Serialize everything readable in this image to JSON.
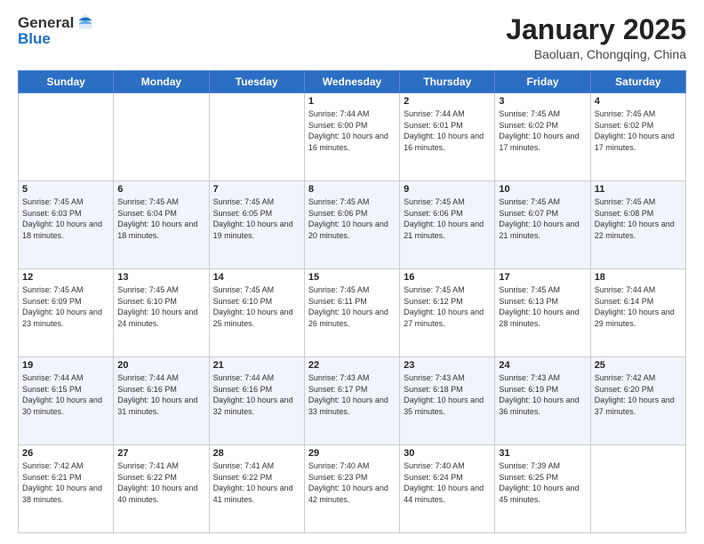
{
  "header": {
    "logo_line1": "General",
    "logo_line2": "Blue",
    "month_title": "January 2025",
    "location": "Baoluan, Chongqing, China"
  },
  "days_of_week": [
    "Sunday",
    "Monday",
    "Tuesday",
    "Wednesday",
    "Thursday",
    "Friday",
    "Saturday"
  ],
  "weeks": [
    [
      {
        "num": "",
        "info": ""
      },
      {
        "num": "",
        "info": ""
      },
      {
        "num": "",
        "info": ""
      },
      {
        "num": "1",
        "info": "Sunrise: 7:44 AM\nSunset: 6:00 PM\nDaylight: 10 hours and 16 minutes."
      },
      {
        "num": "2",
        "info": "Sunrise: 7:44 AM\nSunset: 6:01 PM\nDaylight: 10 hours and 16 minutes."
      },
      {
        "num": "3",
        "info": "Sunrise: 7:45 AM\nSunset: 6:02 PM\nDaylight: 10 hours and 17 minutes."
      },
      {
        "num": "4",
        "info": "Sunrise: 7:45 AM\nSunset: 6:02 PM\nDaylight: 10 hours and 17 minutes."
      }
    ],
    [
      {
        "num": "5",
        "info": "Sunrise: 7:45 AM\nSunset: 6:03 PM\nDaylight: 10 hours and 18 minutes."
      },
      {
        "num": "6",
        "info": "Sunrise: 7:45 AM\nSunset: 6:04 PM\nDaylight: 10 hours and 18 minutes."
      },
      {
        "num": "7",
        "info": "Sunrise: 7:45 AM\nSunset: 6:05 PM\nDaylight: 10 hours and 19 minutes."
      },
      {
        "num": "8",
        "info": "Sunrise: 7:45 AM\nSunset: 6:06 PM\nDaylight: 10 hours and 20 minutes."
      },
      {
        "num": "9",
        "info": "Sunrise: 7:45 AM\nSunset: 6:06 PM\nDaylight: 10 hours and 21 minutes."
      },
      {
        "num": "10",
        "info": "Sunrise: 7:45 AM\nSunset: 6:07 PM\nDaylight: 10 hours and 21 minutes."
      },
      {
        "num": "11",
        "info": "Sunrise: 7:45 AM\nSunset: 6:08 PM\nDaylight: 10 hours and 22 minutes."
      }
    ],
    [
      {
        "num": "12",
        "info": "Sunrise: 7:45 AM\nSunset: 6:09 PM\nDaylight: 10 hours and 23 minutes."
      },
      {
        "num": "13",
        "info": "Sunrise: 7:45 AM\nSunset: 6:10 PM\nDaylight: 10 hours and 24 minutes."
      },
      {
        "num": "14",
        "info": "Sunrise: 7:45 AM\nSunset: 6:10 PM\nDaylight: 10 hours and 25 minutes."
      },
      {
        "num": "15",
        "info": "Sunrise: 7:45 AM\nSunset: 6:11 PM\nDaylight: 10 hours and 26 minutes."
      },
      {
        "num": "16",
        "info": "Sunrise: 7:45 AM\nSunset: 6:12 PM\nDaylight: 10 hours and 27 minutes."
      },
      {
        "num": "17",
        "info": "Sunrise: 7:45 AM\nSunset: 6:13 PM\nDaylight: 10 hours and 28 minutes."
      },
      {
        "num": "18",
        "info": "Sunrise: 7:44 AM\nSunset: 6:14 PM\nDaylight: 10 hours and 29 minutes."
      }
    ],
    [
      {
        "num": "19",
        "info": "Sunrise: 7:44 AM\nSunset: 6:15 PM\nDaylight: 10 hours and 30 minutes."
      },
      {
        "num": "20",
        "info": "Sunrise: 7:44 AM\nSunset: 6:16 PM\nDaylight: 10 hours and 31 minutes."
      },
      {
        "num": "21",
        "info": "Sunrise: 7:44 AM\nSunset: 6:16 PM\nDaylight: 10 hours and 32 minutes."
      },
      {
        "num": "22",
        "info": "Sunrise: 7:43 AM\nSunset: 6:17 PM\nDaylight: 10 hours and 33 minutes."
      },
      {
        "num": "23",
        "info": "Sunrise: 7:43 AM\nSunset: 6:18 PM\nDaylight: 10 hours and 35 minutes."
      },
      {
        "num": "24",
        "info": "Sunrise: 7:43 AM\nSunset: 6:19 PM\nDaylight: 10 hours and 36 minutes."
      },
      {
        "num": "25",
        "info": "Sunrise: 7:42 AM\nSunset: 6:20 PM\nDaylight: 10 hours and 37 minutes."
      }
    ],
    [
      {
        "num": "26",
        "info": "Sunrise: 7:42 AM\nSunset: 6:21 PM\nDaylight: 10 hours and 38 minutes."
      },
      {
        "num": "27",
        "info": "Sunrise: 7:41 AM\nSunset: 6:22 PM\nDaylight: 10 hours and 40 minutes."
      },
      {
        "num": "28",
        "info": "Sunrise: 7:41 AM\nSunset: 6:22 PM\nDaylight: 10 hours and 41 minutes."
      },
      {
        "num": "29",
        "info": "Sunrise: 7:40 AM\nSunset: 6:23 PM\nDaylight: 10 hours and 42 minutes."
      },
      {
        "num": "30",
        "info": "Sunrise: 7:40 AM\nSunset: 6:24 PM\nDaylight: 10 hours and 44 minutes."
      },
      {
        "num": "31",
        "info": "Sunrise: 7:39 AM\nSunset: 6:25 PM\nDaylight: 10 hours and 45 minutes."
      },
      {
        "num": "",
        "info": ""
      }
    ]
  ]
}
